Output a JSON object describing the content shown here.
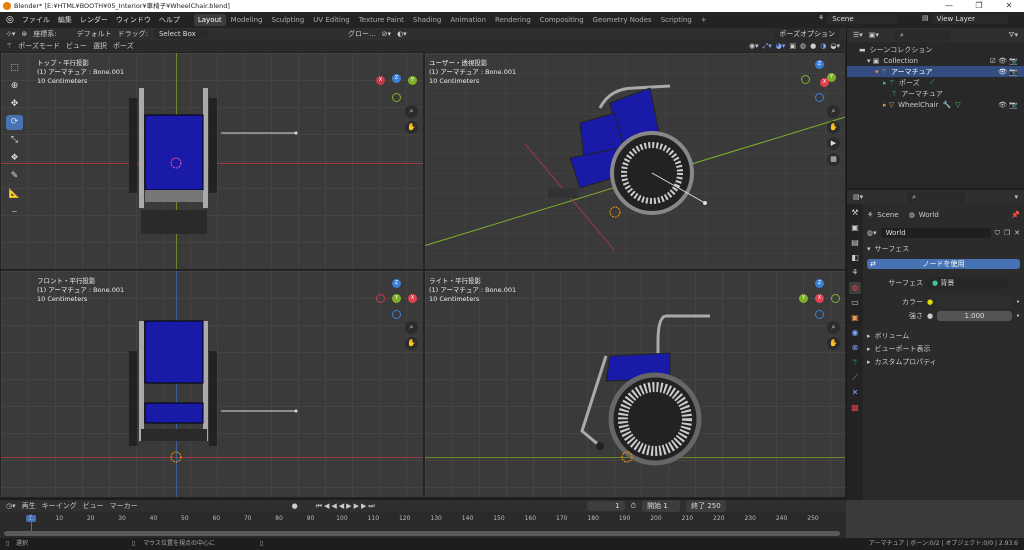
{
  "window": {
    "title": "Blender* [E:¥HTML¥BOOTH¥05_Interior¥車椅子¥WheelChair.blend]",
    "minimize": "—",
    "restore": "❐",
    "close": "✕"
  },
  "menu": [
    "ファイル",
    "編集",
    "レンダー",
    "ウィンドウ",
    "ヘルプ"
  ],
  "workspaces": [
    "Layout",
    "Modeling",
    "Sculpting",
    "UV Editing",
    "Texture Paint",
    "Shading",
    "Animation",
    "Rendering",
    "Compositing",
    "Geometry Nodes",
    "Scripting",
    "+"
  ],
  "scene": {
    "label": "Scene",
    "view_layer": "View Layer"
  },
  "viewport_header": {
    "coord_label": "座標系:",
    "coord_value": "デフォルト",
    "drag_label": "ドラッグ:",
    "drag_value": "Select Box",
    "orientation": "グロー...",
    "mode": "ポーズモード",
    "view": "ビュー",
    "select": "選択",
    "pose": "ポーズ",
    "pose_options": "ポーズオプション"
  },
  "viewports": [
    {
      "title": "トップ・平行投影",
      "sub": "(1) アーマチュア : Bone.001",
      "scale": "10 Centimeters"
    },
    {
      "title": "ユーザー・透視投影",
      "sub": "(1) アーマチュア : Bone.001",
      "scale": "10 Centimeters"
    },
    {
      "title": "フロント・平行投影",
      "sub": "(1) アーマチュア : Bone.001",
      "scale": "10 Centimeters"
    },
    {
      "title": "ライト・平行投影",
      "sub": "(1) アーマチュア : Bone.001",
      "scale": "10 Centimeters"
    }
  ],
  "gizmo": {
    "x": "X",
    "y": "Y",
    "z": "Z"
  },
  "outliner": {
    "items": [
      {
        "label": "シーンコレクション",
        "depth": 0
      },
      {
        "label": "Collection",
        "depth": 1
      },
      {
        "label": "アーマチュア",
        "depth": 2,
        "selected": true
      },
      {
        "label": "ポーズ",
        "depth": 3
      },
      {
        "label": "アーマチュア",
        "depth": 3
      },
      {
        "label": "WheelChair",
        "depth": 2
      }
    ]
  },
  "properties": {
    "breadcrumb_scene": "Scene",
    "breadcrumb_world": "World",
    "world_name": "World",
    "surface_panel": "サーフェス",
    "use_nodes": "ノードを使用",
    "surface_label": "サーフェス",
    "surface_value": "背景",
    "color_label": "カラー",
    "strength_label": "強さ",
    "strength_value": "1.000",
    "panels": [
      "ボリューム",
      "ビューポート表示",
      "カスタムプロパティ"
    ]
  },
  "timeline": {
    "playback": "再生",
    "keying": "キーイング",
    "view": "ビュー",
    "marker": "マーカー",
    "current_frame": "1",
    "start_label": "開始",
    "start": "1",
    "end_label": "終了",
    "end": "250",
    "ticks": [
      "1",
      "10",
      "20",
      "30",
      "40",
      "50",
      "60",
      "70",
      "80",
      "90",
      "100",
      "110",
      "120",
      "130",
      "140",
      "150",
      "160",
      "170",
      "180",
      "190",
      "200",
      "210",
      "220",
      "230",
      "240",
      "250"
    ]
  },
  "status": {
    "select": "選択",
    "center": "マウス位置を視点の中心に",
    "info": "アーマチュア | ボーン:0/2 | オブジェクト:0/0 | 2.93.6"
  },
  "colors": {
    "accent": "#4772b3",
    "seat": "#1a1aa8",
    "x_axis": "#e0404f",
    "y_axis": "#7fb02a",
    "z_axis": "#3b7fd6"
  }
}
